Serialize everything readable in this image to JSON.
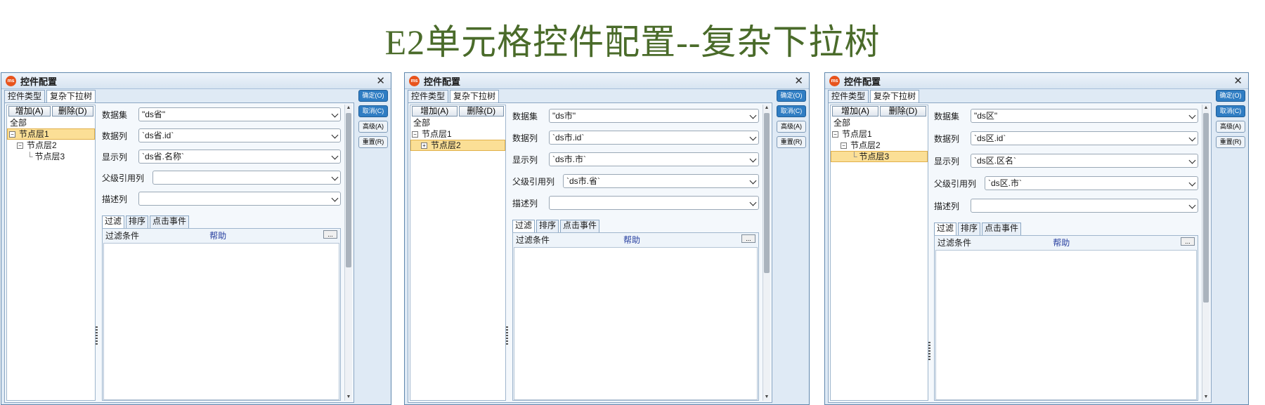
{
  "title": "E2单元格控件配置--复杂下拉树",
  "colors": {
    "title": "#4a6b2a",
    "selection": "#fbdf96",
    "primary_button": "#2f7dc3"
  },
  "dialogs": [
    {
      "title": "控件配置",
      "logo_text": "ms",
      "tabs": [
        "控件类型",
        "复杂下拉树"
      ],
      "tree_buttons": [
        "增加(A)",
        "删除(D)"
      ],
      "tree_items": [
        "全部",
        "节点层1",
        "节点层2",
        "节点层3"
      ],
      "fields": {
        "dataset_label": "数据集",
        "dataset_value": "\"ds省\"",
        "datacol_label": "数据列",
        "datacol_value": "`ds省.id`",
        "displaycol_label": "显示列",
        "displaycol_value": "`ds省.名称`",
        "parentref_label": "父级引用列",
        "parentref_value": "",
        "desc_label": "描述列",
        "desc_value": ""
      },
      "subtabs": [
        "过滤",
        "排序",
        "点击事件"
      ],
      "filter_label": "过滤条件",
      "help_label": "帮助",
      "ellipsis": "...",
      "side_buttons": [
        "确定(O)",
        "取消(C)",
        "高级(A)",
        "重置(R)"
      ]
    },
    {
      "title": "控件配置",
      "logo_text": "ms",
      "tabs": [
        "控件类型",
        "复杂下拉树"
      ],
      "tree_buttons": [
        "增加(A)",
        "删除(D)"
      ],
      "tree_items": [
        "全部",
        "节点层1",
        "节点层2"
      ],
      "fields": {
        "dataset_label": "数据集",
        "dataset_value": "\"ds市\"",
        "datacol_label": "数据列",
        "datacol_value": "`ds市.id`",
        "displaycol_label": "显示列",
        "displaycol_value": "`ds市.市`",
        "parentref_label": "父级引用列",
        "parentref_value": "`ds市.省`",
        "desc_label": "描述列",
        "desc_value": ""
      },
      "subtabs": [
        "过滤",
        "排序",
        "点击事件"
      ],
      "filter_label": "过滤条件",
      "help_label": "帮助",
      "ellipsis": "...",
      "side_buttons": [
        "确定(O)",
        "取消(C)",
        "高级(A)",
        "重置(R)"
      ]
    },
    {
      "title": "控件配置",
      "logo_text": "ms",
      "tabs": [
        "控件类型",
        "复杂下拉树"
      ],
      "tree_buttons": [
        "增加(A)",
        "删除(D)"
      ],
      "tree_items": [
        "全部",
        "节点层1",
        "节点层2",
        "节点层3"
      ],
      "fields": {
        "dataset_label": "数据集",
        "dataset_value": "\"ds区\"",
        "datacol_label": "数据列",
        "datacol_value": "`ds区.id`",
        "displaycol_label": "显示列",
        "displaycol_value": "`ds区.区名`",
        "parentref_label": "父级引用列",
        "parentref_value": "`ds区.市`",
        "desc_label": "描述列",
        "desc_value": ""
      },
      "subtabs": [
        "过滤",
        "排序",
        "点击事件"
      ],
      "filter_label": "过滤条件",
      "help_label": "帮助",
      "ellipsis": "...",
      "side_buttons": [
        "确定(O)",
        "取消(C)",
        "高级(A)",
        "重置(R)"
      ]
    }
  ]
}
